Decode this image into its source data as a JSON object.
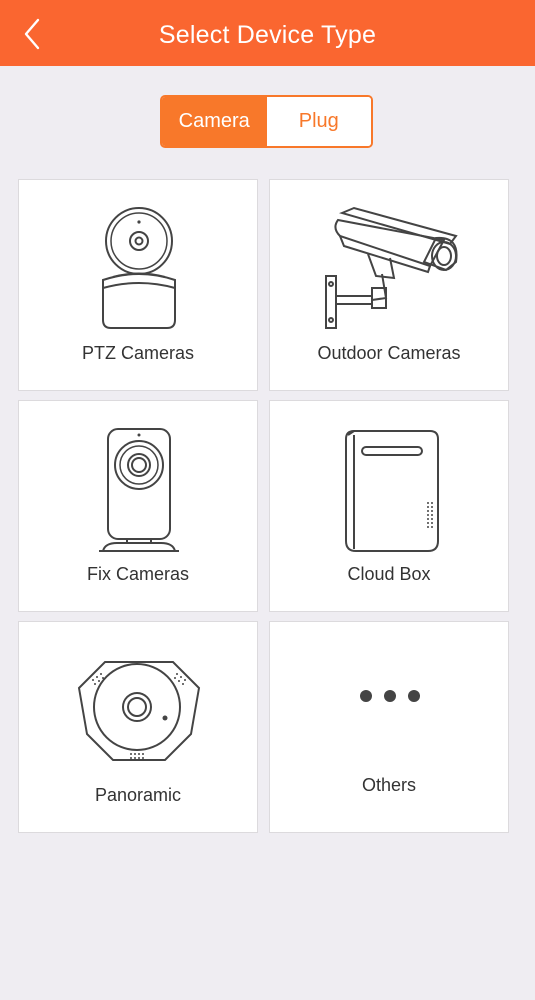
{
  "header": {
    "title": "Select Device Type",
    "back_icon": "chevron-left-icon"
  },
  "segment": {
    "tabs": [
      {
        "label": "Camera",
        "active": true
      },
      {
        "label": "Plug",
        "active": false
      }
    ]
  },
  "devices": [
    {
      "label": "PTZ Cameras",
      "icon": "ptz-camera-icon"
    },
    {
      "label": "Outdoor Cameras",
      "icon": "outdoor-camera-icon"
    },
    {
      "label": "Fix Cameras",
      "icon": "fix-camera-icon"
    },
    {
      "label": "Cloud Box",
      "icon": "cloud-box-icon"
    },
    {
      "label": "Panoramic",
      "icon": "panoramic-camera-icon"
    },
    {
      "label": "Others",
      "icon": "more-dots-icon"
    }
  ],
  "colors": {
    "accent": "#fa6630",
    "segment_accent": "#f8782a",
    "background": "#efedf2"
  }
}
